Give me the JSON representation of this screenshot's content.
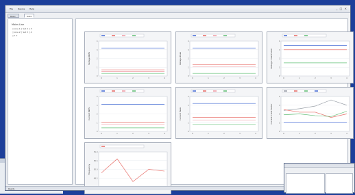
{
  "window": {
    "menu": [
      "File",
      "Device",
      "Help"
    ],
    "controls": "_ □ ×",
    "tabs": [
      "Basic Setup",
      "Data"
    ],
    "status": "Ready"
  },
  "left_panel": {
    "title": "Mains Line",
    "rows": [
      "▯ Line 1 ▯ Set 2 ▯ 3",
      "▯ Line 2 ▯ Set 3 ▯ 4",
      "▯ 1 2"
    ]
  },
  "colors": {
    "blue": "#4a6fd6",
    "red": "#e8706a",
    "pink": "#f0a0a8",
    "green": "#66c07a",
    "gray": "#9aa0a8",
    "teal": "#3aa08a"
  },
  "chart_data": [
    {
      "type": "line",
      "ylabel": "Voltage RMS",
      "x": [
        0,
        1,
        2,
        3,
        4
      ],
      "ylim": [
        0,
        4
      ],
      "series": [
        {
          "color": "#4a6fd6",
          "values": [
            3.2,
            3.2,
            3.2,
            3.2,
            3.2
          ]
        },
        {
          "color": "#e8706a",
          "values": [
            0.7,
            0.7,
            0.7,
            0.7,
            0.7
          ]
        },
        {
          "color": "#f0a0a8",
          "values": [
            0.5,
            0.5,
            0.5,
            0.5,
            0.5
          ]
        },
        {
          "color": "#66c07a",
          "values": [
            0.3,
            0.3,
            0.3,
            0.3,
            0.3
          ]
        }
      ]
    },
    {
      "type": "line",
      "ylabel": "Voltage Peak",
      "x": [
        0,
        1,
        2,
        3,
        4
      ],
      "ylim": [
        0,
        4
      ],
      "series": [
        {
          "color": "#4a6fd6",
          "values": [
            3.2,
            3.2,
            3.2,
            3.2,
            3.2
          ]
        },
        {
          "color": "#e8706a",
          "values": [
            1.3,
            1.3,
            1.3,
            1.3,
            1.3
          ]
        },
        {
          "color": "#f0a0a8",
          "values": [
            1.1,
            1.1,
            1.1,
            1.1,
            1.1
          ]
        },
        {
          "color": "#66c07a",
          "values": [
            0.3,
            0.3,
            0.3,
            0.3,
            0.3
          ]
        }
      ]
    },
    {
      "type": "line",
      "ylabel": "Voltage Crest Factor",
      "x": [
        0,
        1,
        2,
        3,
        4
      ],
      "ylim": [
        0,
        4
      ],
      "series": [
        {
          "color": "#4a6fd6",
          "values": [
            3.5,
            3.5,
            3.5,
            3.5,
            3.5
          ]
        },
        {
          "color": "#e8706a",
          "values": [
            3.0,
            3.0,
            3.0,
            3.0,
            3.0
          ]
        },
        {
          "color": "#66c07a",
          "values": [
            1.5,
            1.5,
            1.5,
            1.5,
            1.5
          ]
        }
      ]
    },
    {
      "type": "line",
      "ylabel": "Current RMS",
      "x": [
        0,
        1,
        2,
        3,
        4
      ],
      "ylim": [
        0,
        4
      ],
      "series": [
        {
          "color": "#4a6fd6",
          "values": [
            3.1,
            3.1,
            3.1,
            3.1,
            3.1
          ]
        },
        {
          "color": "#e8706a",
          "values": [
            1.0,
            1.0,
            1.0,
            1.0,
            1.0
          ]
        },
        {
          "color": "#f0a0a8",
          "values": [
            0.8,
            0.8,
            0.8,
            0.8,
            0.8
          ]
        },
        {
          "color": "#66c07a",
          "values": [
            0.4,
            0.4,
            0.4,
            0.4,
            0.4
          ]
        }
      ]
    },
    {
      "type": "line",
      "ylabel": "Current Peak",
      "x": [
        0,
        1,
        2,
        3,
        4
      ],
      "ylim": [
        0,
        4
      ],
      "series": [
        {
          "color": "#4a6fd6",
          "values": [
            3.2,
            3.2,
            3.2,
            3.2,
            3.2
          ]
        },
        {
          "color": "#e8706a",
          "values": [
            1.6,
            1.6,
            1.6,
            1.6,
            1.6
          ]
        },
        {
          "color": "#f0a0a8",
          "values": [
            1.3,
            1.3,
            1.3,
            1.3,
            1.3
          ]
        },
        {
          "color": "#66c07a",
          "values": [
            0.8,
            0.8,
            0.8,
            0.8,
            0.8
          ]
        }
      ]
    },
    {
      "type": "line",
      "ylabel": "Current Crest Factor",
      "x": [
        0,
        1,
        2,
        3,
        4
      ],
      "ylim": [
        0,
        4
      ],
      "series": [
        {
          "color": "#9aa0a8",
          "values": [
            2.4,
            2.6,
            2.9,
            3.6,
            3.0
          ]
        },
        {
          "color": "#e8706a",
          "values": [
            2.5,
            2.2,
            2.2,
            1.6,
            2.0
          ]
        },
        {
          "color": "#66c07a",
          "values": [
            1.9,
            2.0,
            1.8,
            1.7,
            2.3
          ]
        },
        {
          "color": "#4a6fd6",
          "values": [
            1.0,
            1.0,
            1.0,
            1.0,
            1.0
          ]
        }
      ]
    },
    {
      "type": "line",
      "ylabel": "Frequency",
      "x": [
        0,
        1,
        2,
        3,
        4
      ],
      "ylim": [
        49.0,
        51.0
      ],
      "series": [
        {
          "color": "#e8706a",
          "values": [
            49.8,
            50.6,
            49.3,
            50.0,
            49.9
          ]
        }
      ]
    }
  ]
}
